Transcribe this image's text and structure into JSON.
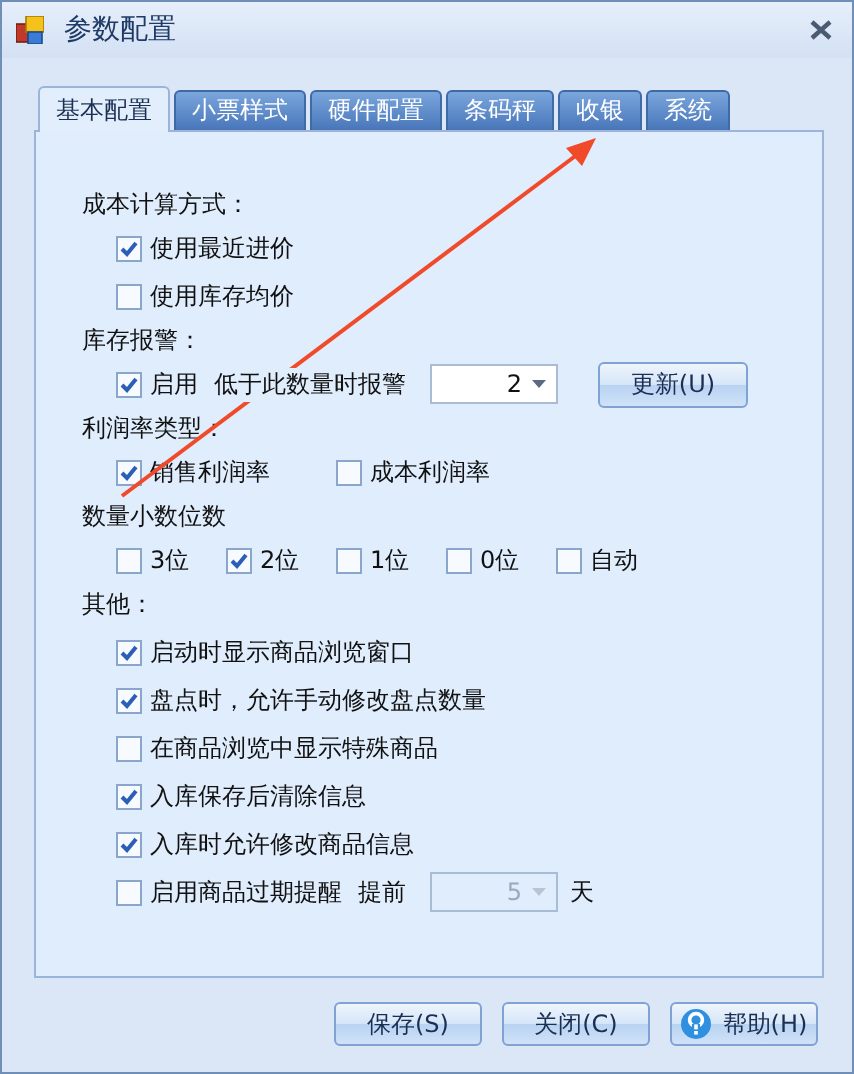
{
  "window": {
    "title": "参数配置"
  },
  "tabs": [
    {
      "label": "基本配置",
      "selected": true
    },
    {
      "label": "小票样式",
      "selected": false
    },
    {
      "label": "硬件配置",
      "selected": false
    },
    {
      "label": "条码秤",
      "selected": false
    },
    {
      "label": "收银",
      "selected": false
    },
    {
      "label": "系统",
      "selected": false
    }
  ],
  "sections": [
    {
      "title": "成本计算方式：",
      "rows": [
        {
          "items": [
            {
              "kind": "checkbox",
              "label": "使用最近进价",
              "checked": true
            }
          ]
        },
        {
          "items": [
            {
              "kind": "checkbox",
              "label": "使用库存均价",
              "checked": false
            }
          ]
        }
      ]
    },
    {
      "title": "库存报警：",
      "rows": [
        {
          "items": [
            {
              "kind": "checkbox",
              "label": "启用",
              "checked": true
            },
            {
              "kind": "text",
              "label": "低于此数量时报警"
            },
            {
              "kind": "spin",
              "value": "2",
              "disabled": false
            },
            {
              "kind": "button",
              "label": "更新(U)"
            }
          ]
        }
      ]
    },
    {
      "title": "利润率类型：",
      "rows": [
        {
          "items": [
            {
              "kind": "checkbox",
              "label": "销售利润率",
              "checked": true
            },
            {
              "kind": "checkbox",
              "label": "成本利润率",
              "checked": false
            }
          ]
        }
      ]
    },
    {
      "title": "数量小数位数",
      "rows": [
        {
          "items": [
            {
              "kind": "checkbox",
              "label": "3位",
              "checked": false
            },
            {
              "kind": "checkbox",
              "label": "2位",
              "checked": true
            },
            {
              "kind": "checkbox",
              "label": "1位",
              "checked": false
            },
            {
              "kind": "checkbox",
              "label": "0位",
              "checked": false
            },
            {
              "kind": "checkbox",
              "label": "自动",
              "checked": false
            }
          ]
        }
      ]
    },
    {
      "title": "其他：",
      "rows": [
        {
          "items": [
            {
              "kind": "checkbox",
              "label": "启动时显示商品浏览窗口",
              "checked": true
            }
          ]
        },
        {
          "items": [
            {
              "kind": "checkbox",
              "label": "盘点时，允许手动修改盘点数量",
              "checked": true
            }
          ]
        },
        {
          "items": [
            {
              "kind": "checkbox",
              "label": "在商品浏览中显示特殊商品",
              "checked": false
            }
          ]
        },
        {
          "items": [
            {
              "kind": "checkbox",
              "label": "入库保存后清除信息",
              "checked": true
            }
          ]
        },
        {
          "items": [
            {
              "kind": "checkbox",
              "label": "入库时允许修改商品信息",
              "checked": true
            }
          ]
        },
        {
          "items": [
            {
              "kind": "checkbox",
              "label": "启用商品过期提醒",
              "checked": false
            },
            {
              "kind": "text",
              "label": "提前"
            },
            {
              "kind": "spin",
              "value": "5",
              "disabled": true
            },
            {
              "kind": "text",
              "label": "天"
            }
          ]
        }
      ]
    }
  ],
  "buttons": [
    {
      "label": "保存(S)",
      "kind": "plain"
    },
    {
      "label": "关闭(C)",
      "kind": "plain"
    },
    {
      "label": "帮助(H)",
      "kind": "help"
    }
  ]
}
